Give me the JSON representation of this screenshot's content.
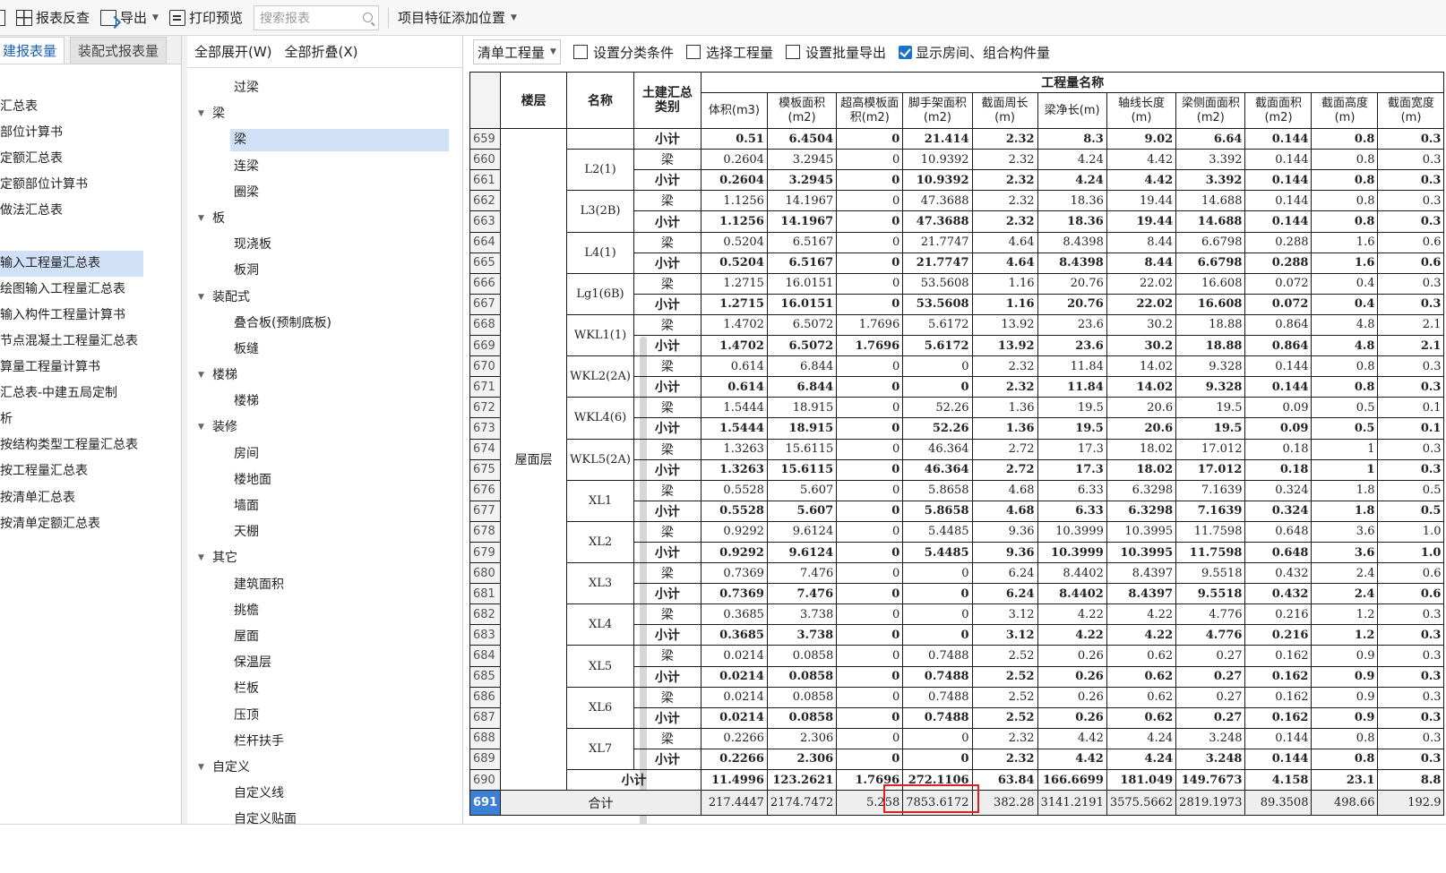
{
  "toolbar": {
    "items": [
      "报表反查",
      "导出",
      "打印预览"
    ],
    "search_placeholder": "搜索报表",
    "feature_label": "项目特征添加位置"
  },
  "left_panel": {
    "tabs": [
      "建报表量",
      "装配式报表量"
    ],
    "items": [
      {
        "label": ""
      },
      {
        "label": "汇总表"
      },
      {
        "label": "部位计算书"
      },
      {
        "label": "定额汇总表"
      },
      {
        "label": "定额部位计算书"
      },
      {
        "label": "做法汇总表"
      },
      {
        "label": ""
      },
      {
        "label": "输入工程量汇总表",
        "selected": true
      },
      {
        "label": "绘图输入工程量汇总表"
      },
      {
        "label": "输入构件工程量计算书"
      },
      {
        "label": "节点混凝土工程量汇总表"
      },
      {
        "label": "算量工程量计算书"
      },
      {
        "label": "汇总表-中建五局定制"
      },
      {
        "label": "析"
      },
      {
        "label": "按结构类型工程量汇总表"
      },
      {
        "label": "按工程量汇总表"
      },
      {
        "label": "按清单汇总表"
      },
      {
        "label": "按清单定额汇总表"
      }
    ]
  },
  "tree_panel": {
    "expand_all": "全部展开(W)",
    "collapse_all": "全部折叠(X)",
    "nodes": [
      {
        "label": "过梁",
        "level": 2
      },
      {
        "label": "梁",
        "level": 1
      },
      {
        "label": "梁",
        "level": 2,
        "selected": true
      },
      {
        "label": "连梁",
        "level": 2
      },
      {
        "label": "圈梁",
        "level": 2
      },
      {
        "label": "板",
        "level": 1
      },
      {
        "label": "现浇板",
        "level": 2
      },
      {
        "label": "板洞",
        "level": 2
      },
      {
        "label": "装配式",
        "level": 1
      },
      {
        "label": "叠合板(预制底板)",
        "level": 2
      },
      {
        "label": "板缝",
        "level": 2
      },
      {
        "label": "楼梯",
        "level": 1
      },
      {
        "label": "楼梯",
        "level": 2
      },
      {
        "label": "装修",
        "level": 1
      },
      {
        "label": "房间",
        "level": 2
      },
      {
        "label": "楼地面",
        "level": 2
      },
      {
        "label": "墙面",
        "level": 2
      },
      {
        "label": "天棚",
        "level": 2
      },
      {
        "label": "其它",
        "level": 1
      },
      {
        "label": "建筑面积",
        "level": 2
      },
      {
        "label": "挑檐",
        "level": 2
      },
      {
        "label": "屋面",
        "level": 2
      },
      {
        "label": "保温层",
        "level": 2
      },
      {
        "label": "栏板",
        "level": 2
      },
      {
        "label": "压顶",
        "level": 2
      },
      {
        "label": "栏杆扶手",
        "level": 2
      },
      {
        "label": "自定义",
        "level": 1
      },
      {
        "label": "自定义线",
        "level": 2
      },
      {
        "label": "自定义贴面",
        "level": 2
      }
    ]
  },
  "right_toolbar": {
    "quantity_select": "清单工程量",
    "set_category": "设置分类条件",
    "select_quantity": "选择工程量",
    "batch_export": "设置批量导出",
    "show_rooms": "显示房间、组合构件量",
    "show_rooms_checked": true
  },
  "table": {
    "header_floor": "楼层",
    "header_name": "名称",
    "header_category": "土建汇总类别",
    "header_group": "工程量名称",
    "columns": [
      "体积(m3)",
      "模板面积(m2)",
      "超高模板面积(m2)",
      "脚手架面积(m2)",
      "截面周长(m)",
      "梁净长(m)",
      "轴线长度(m)",
      "梁侧面面积(m2)",
      "截面面积(m2)",
      "截面高度(m)",
      "截面宽度(m)"
    ],
    "floor": "屋面层",
    "row_start": 659,
    "groups": [
      {
        "name": "",
        "rows": [
          {
            "kind": "小计",
            "values": [
              "0.51",
              "6.4504",
              "0",
              "21.414",
              "2.32",
              "8.3",
              "9.02",
              "6.64",
              "0.144",
              "0.8",
              "0.3"
            ]
          }
        ]
      },
      {
        "name": "L2(1)",
        "rows": [
          {
            "kind": "梁",
            "values": [
              "0.2604",
              "3.2945",
              "0",
              "10.9392",
              "2.32",
              "4.24",
              "4.42",
              "3.392",
              "0.144",
              "0.8",
              "0.3"
            ]
          },
          {
            "kind": "小计",
            "values": [
              "0.2604",
              "3.2945",
              "0",
              "10.9392",
              "2.32",
              "4.24",
              "4.42",
              "3.392",
              "0.144",
              "0.8",
              "0.3"
            ]
          }
        ]
      },
      {
        "name": "L3(2B)",
        "rows": [
          {
            "kind": "梁",
            "values": [
              "1.1256",
              "14.1967",
              "0",
              "47.3688",
              "2.32",
              "18.36",
              "19.44",
              "14.688",
              "0.144",
              "0.8",
              "0.3"
            ]
          },
          {
            "kind": "小计",
            "values": [
              "1.1256",
              "14.1967",
              "0",
              "47.3688",
              "2.32",
              "18.36",
              "19.44",
              "14.688",
              "0.144",
              "0.8",
              "0.3"
            ]
          }
        ]
      },
      {
        "name": "L4(1)",
        "rows": [
          {
            "kind": "梁",
            "values": [
              "0.5204",
              "6.5167",
              "0",
              "21.7747",
              "4.64",
              "8.4398",
              "8.44",
              "6.6798",
              "0.288",
              "1.6",
              "0.6"
            ]
          },
          {
            "kind": "小计",
            "values": [
              "0.5204",
              "6.5167",
              "0",
              "21.7747",
              "4.64",
              "8.4398",
              "8.44",
              "6.6798",
              "0.288",
              "1.6",
              "0.6"
            ]
          }
        ]
      },
      {
        "name": "Lg1(6B)",
        "rows": [
          {
            "kind": "梁",
            "values": [
              "1.2715",
              "16.0151",
              "0",
              "53.5608",
              "1.16",
              "20.76",
              "22.02",
              "16.608",
              "0.072",
              "0.4",
              "0.3"
            ]
          },
          {
            "kind": "小计",
            "values": [
              "1.2715",
              "16.0151",
              "0",
              "53.5608",
              "1.16",
              "20.76",
              "22.02",
              "16.608",
              "0.072",
              "0.4",
              "0.3"
            ]
          }
        ]
      },
      {
        "name": "WKL1(1)",
        "rows": [
          {
            "kind": "梁",
            "values": [
              "1.4702",
              "6.5072",
              "1.7696",
              "5.6172",
              "13.92",
              "23.6",
              "30.2",
              "18.88",
              "0.864",
              "4.8",
              "2.1"
            ]
          },
          {
            "kind": "小计",
            "values": [
              "1.4702",
              "6.5072",
              "1.7696",
              "5.6172",
              "13.92",
              "23.6",
              "30.2",
              "18.88",
              "0.864",
              "4.8",
              "2.1"
            ]
          }
        ]
      },
      {
        "name": "WKL2(2A)",
        "rows": [
          {
            "kind": "梁",
            "values": [
              "0.614",
              "6.844",
              "0",
              "0",
              "2.32",
              "11.84",
              "14.02",
              "9.328",
              "0.144",
              "0.8",
              "0.3"
            ]
          },
          {
            "kind": "小计",
            "values": [
              "0.614",
              "6.844",
              "0",
              "0",
              "2.32",
              "11.84",
              "14.02",
              "9.328",
              "0.144",
              "0.8",
              "0.3"
            ]
          }
        ]
      },
      {
        "name": "WKL4(6)",
        "rows": [
          {
            "kind": "梁",
            "values": [
              "1.5444",
              "18.915",
              "0",
              "52.26",
              "1.36",
              "19.5",
              "20.6",
              "19.5",
              "0.09",
              "0.5",
              "0.1"
            ]
          },
          {
            "kind": "小计",
            "values": [
              "1.5444",
              "18.915",
              "0",
              "52.26",
              "1.36",
              "19.5",
              "20.6",
              "19.5",
              "0.09",
              "0.5",
              "0.1"
            ]
          }
        ]
      },
      {
        "name": "WKL5(2A)",
        "rows": [
          {
            "kind": "梁",
            "values": [
              "1.3263",
              "15.6115",
              "0",
              "46.364",
              "2.72",
              "17.3",
              "18.02",
              "17.012",
              "0.18",
              "1",
              "0.3"
            ]
          },
          {
            "kind": "小计",
            "values": [
              "1.3263",
              "15.6115",
              "0",
              "46.364",
              "2.72",
              "17.3",
              "18.02",
              "17.012",
              "0.18",
              "1",
              "0.3"
            ]
          }
        ]
      },
      {
        "name": "XL1",
        "rows": [
          {
            "kind": "梁",
            "values": [
              "0.5528",
              "5.607",
              "0",
              "5.8658",
              "4.68",
              "6.33",
              "6.3298",
              "7.1639",
              "0.324",
              "1.8",
              "0.5"
            ]
          },
          {
            "kind": "小计",
            "values": [
              "0.5528",
              "5.607",
              "0",
              "5.8658",
              "4.68",
              "6.33",
              "6.3298",
              "7.1639",
              "0.324",
              "1.8",
              "0.5"
            ]
          }
        ]
      },
      {
        "name": "XL2",
        "rows": [
          {
            "kind": "梁",
            "values": [
              "0.9292",
              "9.6124",
              "0",
              "5.4485",
              "9.36",
              "10.3999",
              "10.3995",
              "11.7598",
              "0.648",
              "3.6",
              "1.0"
            ]
          },
          {
            "kind": "小计",
            "values": [
              "0.9292",
              "9.6124",
              "0",
              "5.4485",
              "9.36",
              "10.3999",
              "10.3995",
              "11.7598",
              "0.648",
              "3.6",
              "1.0"
            ]
          }
        ]
      },
      {
        "name": "XL3",
        "rows": [
          {
            "kind": "梁",
            "values": [
              "0.7369",
              "7.476",
              "0",
              "0",
              "6.24",
              "8.4402",
              "8.4397",
              "9.5518",
              "0.432",
              "2.4",
              "0.6"
            ]
          },
          {
            "kind": "小计",
            "values": [
              "0.7369",
              "7.476",
              "0",
              "0",
              "6.24",
              "8.4402",
              "8.4397",
              "9.5518",
              "0.432",
              "2.4",
              "0.6"
            ]
          }
        ]
      },
      {
        "name": "XL4",
        "rows": [
          {
            "kind": "梁",
            "values": [
              "0.3685",
              "3.738",
              "0",
              "0",
              "3.12",
              "4.22",
              "4.22",
              "4.776",
              "0.216",
              "1.2",
              "0.3"
            ]
          },
          {
            "kind": "小计",
            "values": [
              "0.3685",
              "3.738",
              "0",
              "0",
              "3.12",
              "4.22",
              "4.22",
              "4.776",
              "0.216",
              "1.2",
              "0.3"
            ]
          }
        ]
      },
      {
        "name": "XL5",
        "rows": [
          {
            "kind": "梁",
            "values": [
              "0.0214",
              "0.0858",
              "0",
              "0.7488",
              "2.52",
              "0.26",
              "0.62",
              "0.27",
              "0.162",
              "0.9",
              "0.3"
            ]
          },
          {
            "kind": "小计",
            "values": [
              "0.0214",
              "0.0858",
              "0",
              "0.7488",
              "2.52",
              "0.26",
              "0.62",
              "0.27",
              "0.162",
              "0.9",
              "0.3"
            ]
          }
        ]
      },
      {
        "name": "XL6",
        "rows": [
          {
            "kind": "梁",
            "values": [
              "0.0214",
              "0.0858",
              "0",
              "0.7488",
              "2.52",
              "0.26",
              "0.62",
              "0.27",
              "0.162",
              "0.9",
              "0.3"
            ]
          },
          {
            "kind": "小计",
            "values": [
              "0.0214",
              "0.0858",
              "0",
              "0.7488",
              "2.52",
              "0.26",
              "0.62",
              "0.27",
              "0.162",
              "0.9",
              "0.3"
            ]
          }
        ]
      },
      {
        "name": "XL7",
        "rows": [
          {
            "kind": "梁",
            "values": [
              "0.2266",
              "2.306",
              "0",
              "0",
              "2.32",
              "4.42",
              "4.24",
              "3.248",
              "0.144",
              "0.8",
              "0.3"
            ]
          },
          {
            "kind": "小计",
            "values": [
              "0.2266",
              "2.306",
              "0",
              "0",
              "2.32",
              "4.42",
              "4.24",
              "3.248",
              "0.144",
              "0.8",
              "0.3"
            ]
          }
        ]
      }
    ],
    "floor_subtotal_label": "小计",
    "floor_subtotal": [
      "11.4996",
      "123.2621",
      "1.7696",
      "272.1106",
      "63.84",
      "166.6699",
      "181.049",
      "149.7673",
      "4.158",
      "23.1",
      "8.8"
    ],
    "total_label": "合计",
    "total": [
      "217.4447",
      "2174.7472",
      "5.258",
      "7853.6172",
      "382.28",
      "3141.2191",
      "3575.5662",
      "2819.1973",
      "89.3508",
      "498.66",
      "192.9"
    ],
    "current_row": 691
  }
}
